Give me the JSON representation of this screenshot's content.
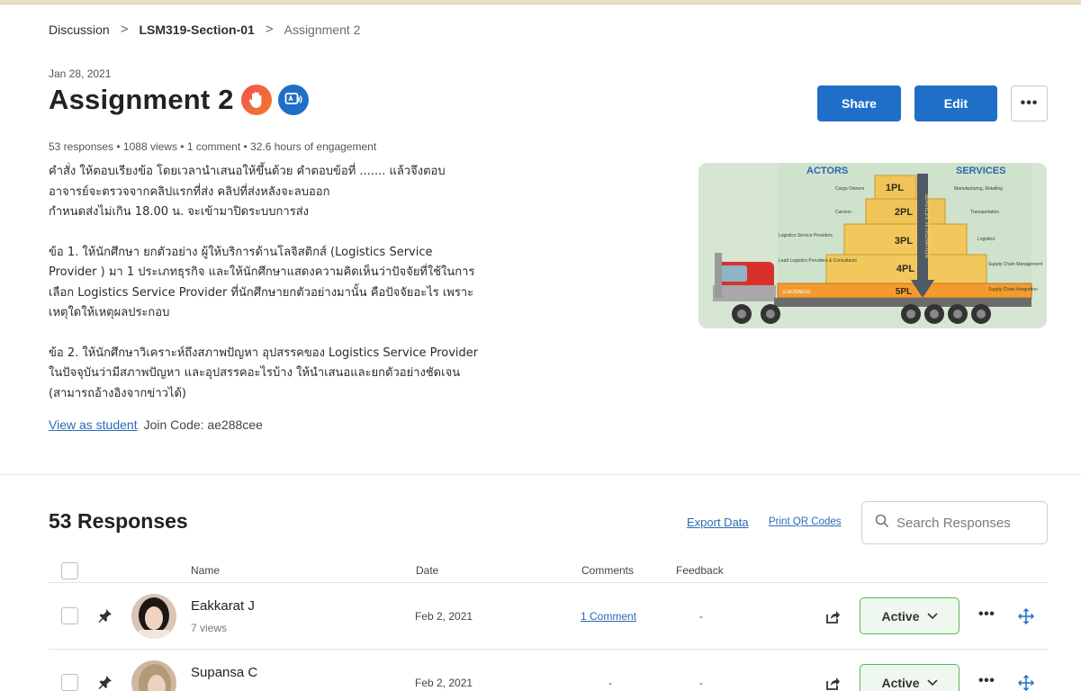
{
  "breadcrumb": {
    "items": [
      "Discussion",
      "LSM319-Section-01",
      "Assignment 2"
    ],
    "separator": ">"
  },
  "header": {
    "date": "Jan 28, 2021",
    "title": "Assignment 2",
    "stats": "53 responses • 1088 views • 1 comment • 32.6 hours of engagement",
    "share_label": "Share",
    "edit_label": "Edit",
    "more_label": "•••"
  },
  "description": {
    "p1": [
      "คำสั่ง ให้ตอบเรียงข้อ โดยเวลานำเสนอให้ขึ้นด้วย คำตอบข้อที่ .......  แล้วจึงตอบ",
      "อาจารย์จะตรวจจากคลิปแรกที่ส่ง คลิปที่ส่งหลังจะลบออก",
      "กำหนดส่งไม่เกิน 18.00 น. จะเข้ามาปิดระบบการส่ง"
    ],
    "p2": [
      "ข้อ 1. ให้นักศึกษา ยกตัวอย่าง ผู้ให้บริการด้านโลจิสติกส์ (Logistics Service",
      "Provider ) มา 1 ประเภทธุรกิจ และให้นักศึกษาแสดงความคิดเห็นว่าปัจจัยที่ใช้ในการ",
      "เลือก Logistics Service Provider ที่นักศึกษายกตัวอย่างมานั้น คือปัจจัยอะไร เพราะ",
      "เหตุใดให้เหตุผลประกอบ"
    ],
    "p3": [
      "ข้อ 2. ให้นักศึกษาวิเคราะห์ถึงสภาพปัญหา อุปสรรคของ Logistics Service Provider",
      "ในปัจจุบันว่ามีสภาพปัญหา และอุปสรรคอะไรบ้าง ให้นำเสนอและยกตัวอย่างชัดเจน",
      "(สามารถอ้างอิงจากข่าวได้)"
    ],
    "view_as_student": "View as student",
    "join_code": "Join Code: ae288cee"
  },
  "hero_image": {
    "actors_label": "ACTORS",
    "services_label": "SERVICES",
    "levels": [
      "1PL",
      "2PL",
      "3PL",
      "4PL",
      "5PL"
    ],
    "left_labels": [
      "Cargo Owners",
      "Carriers",
      "Logistics Service Providers",
      "Lead Logistics Providers & Consultants",
      "E-BUSINESS"
    ],
    "right_labels": [
      "Manufacturing, Retailing",
      "Transportation",
      "Logistics",
      "Supply Chain Management",
      "Supply Chain Integration"
    ],
    "arrow_label": "SERVICES INTEGRATION"
  },
  "responses": {
    "title": "53 Responses",
    "export_label": "Export Data",
    "print_qr_label": "Print QR Codes",
    "search_placeholder": "Search Responses",
    "columns": {
      "name": "Name",
      "date": "Date",
      "comments": "Comments",
      "feedback": "Feedback"
    },
    "rows": [
      {
        "name": "Eakkarat J",
        "views": "7 views",
        "date": "Feb 2, 2021",
        "comments": "1 Comment",
        "feedback": "-",
        "status": "Active"
      },
      {
        "name": "Supansa C",
        "views": "",
        "date": "Feb 2, 2021",
        "comments": "-",
        "feedback": "-",
        "status": "Active"
      }
    ]
  },
  "colors": {
    "primary": "#1f6fc9",
    "link": "#2a6bb5",
    "active_border": "#58b45a",
    "active_bg": "#eef8ee"
  }
}
